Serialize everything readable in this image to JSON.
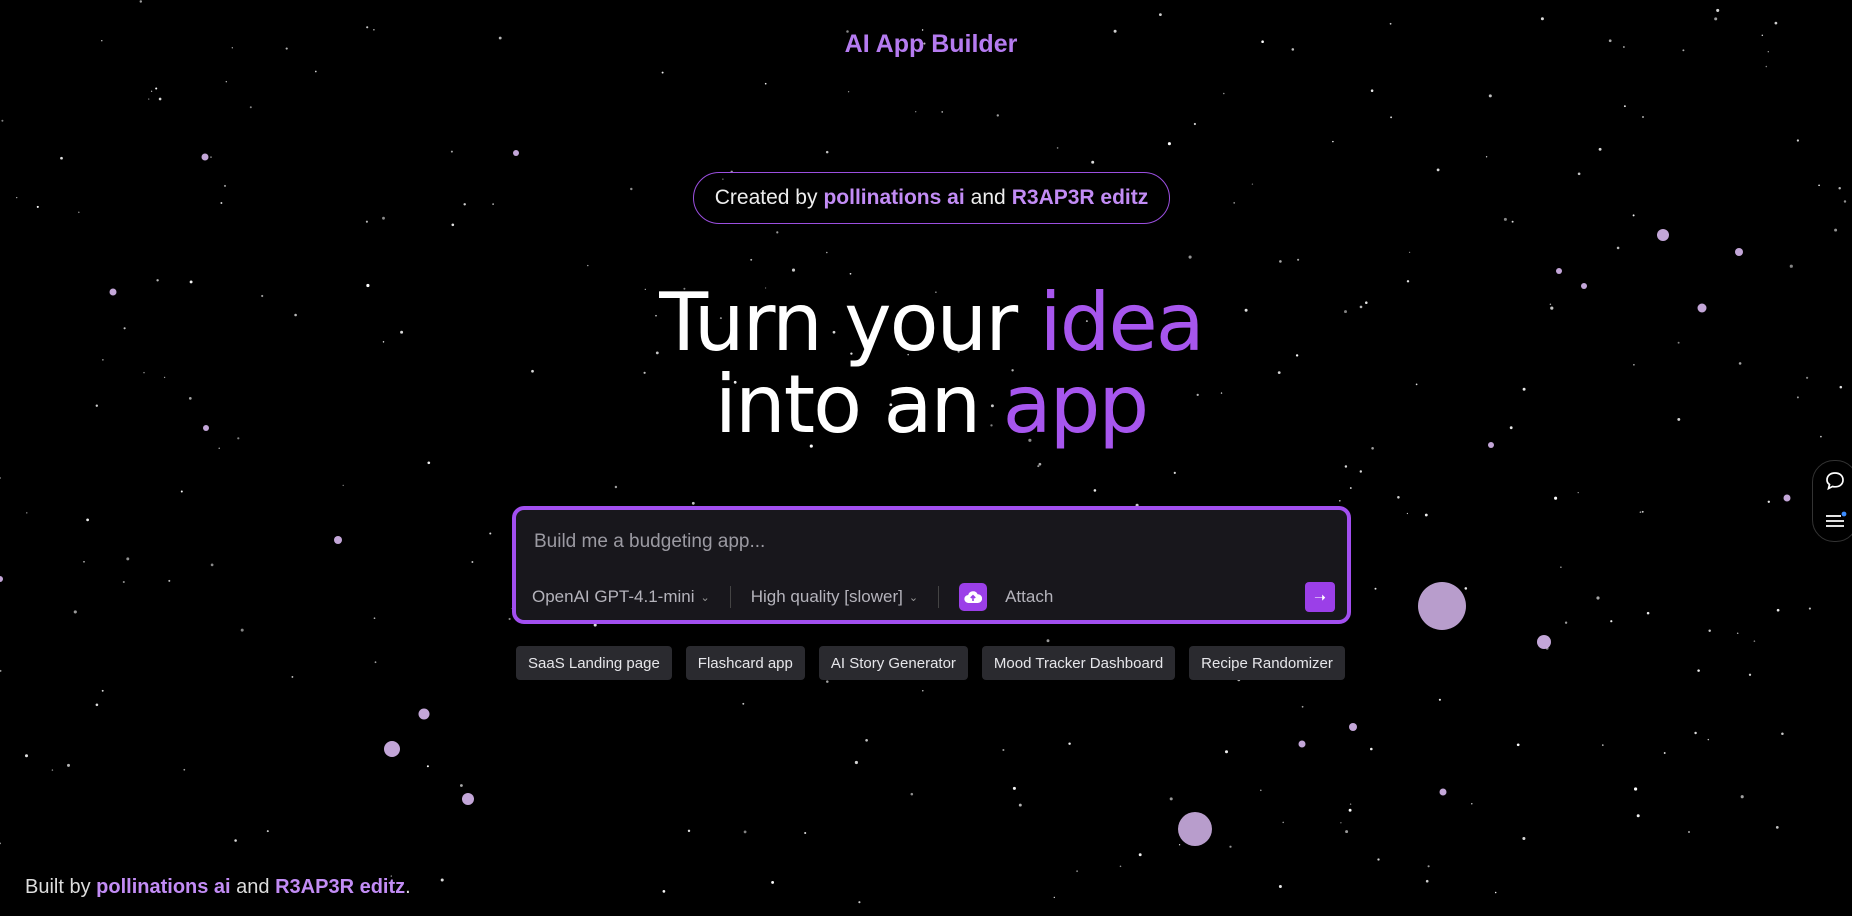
{
  "header": {
    "title": "AI App Builder"
  },
  "credit": {
    "prefix": "Created by",
    "author1": "pollinations ai",
    "joiner": "and",
    "author2": "R3AP3R editz"
  },
  "hero": {
    "line1_prefix": "Turn your",
    "line1_accent": "idea",
    "line2_prefix": "into an",
    "line2_accent": "app"
  },
  "prompt": {
    "placeholder": "Build me a budgeting app...",
    "model_label": "OpenAI GPT-4.1-mini",
    "quality_label": "High quality [slower]",
    "attach_label": "Attach",
    "send_icon": "arrow-right-icon"
  },
  "suggestions": [
    "SaaS Landing page",
    "Flashcard app",
    "AI Story Generator",
    "Mood Tracker Dashboard",
    "Recipe Randomizer"
  ],
  "side_dock": {
    "icons": [
      "chat-bubble-icon",
      "menu-list-icon"
    ]
  },
  "footer": {
    "prefix": "Built by",
    "author1": "pollinations ai",
    "joiner": "and",
    "author2": "R3AP3R editz",
    "suffix": "."
  },
  "colors": {
    "background": "#000000",
    "accent": "#a756ee",
    "link": "#c28cf5",
    "input_bg": "#18171c",
    "chip_bg": "#2a2a2f",
    "star": "#d8b8f0"
  }
}
